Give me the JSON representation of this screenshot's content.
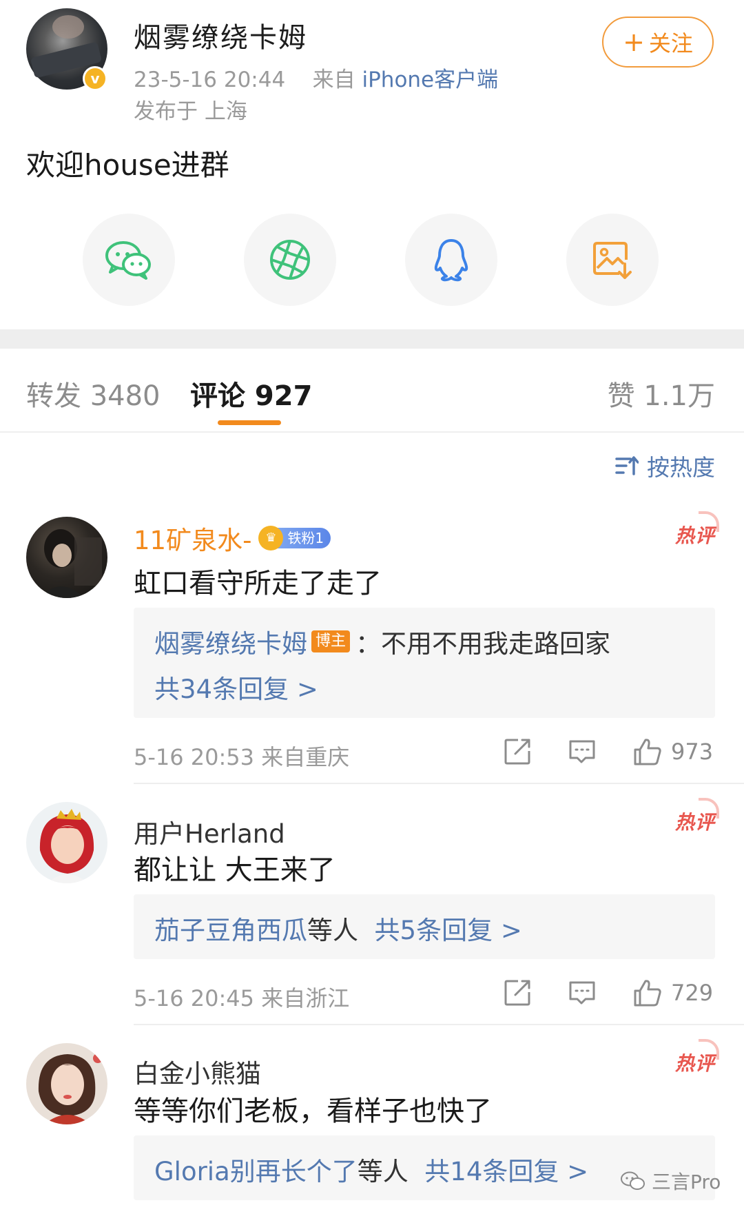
{
  "post": {
    "username": "烟雾缭绕卡姆",
    "timestamp": "23-5-16 20:44",
    "source_prefix": "来自",
    "source_device": "iPhone客户端",
    "location": "发布于 上海",
    "follow_label": "关注",
    "follow_plus": "+",
    "verified_mark": "v",
    "text": "欢迎house进群"
  },
  "share": {
    "icons": [
      "wechat-icon",
      "moments-icon",
      "qq-icon",
      "save-image-icon"
    ],
    "colors": {
      "wechat": "#3fc27a",
      "moments": "#3fc27a",
      "qq": "#3b82e8",
      "save": "#f2a03a"
    }
  },
  "tabs": {
    "repost": "转发 3480",
    "comment": "评论 927",
    "like": "赞 1.1万",
    "accent": "#f28a1d"
  },
  "sort": {
    "label": "按热度"
  },
  "comments": [
    {
      "name": "11矿泉水-",
      "fan_badge": "铁粉1",
      "hot": "热评",
      "text": "虹口看守所走了走了",
      "reply_author": "烟雾缭绕卡姆",
      "reply_author_badge": "博主",
      "reply_text": "：不用不用我走路回家",
      "reply_count": "共34条回复 >",
      "time": "5-16 20:53 来自重庆",
      "likes": "973"
    },
    {
      "name": "用户Herland",
      "hot": "热评",
      "text": "都让让 大王来了",
      "reply_users": "茄子豆角西瓜",
      "reply_users_suffix": "等人",
      "reply_count": "共5条回复 >",
      "time": "5-16 20:45 来自浙江",
      "likes": "729"
    },
    {
      "name": "白金小熊猫",
      "hot": "热评",
      "text": "等等你们老板，看样子也快了",
      "reply_users": "Gloria别再长个了",
      "reply_users_suffix": "等人",
      "reply_count": "共14条回复 >"
    }
  ],
  "watermark": {
    "text": "三言Pro"
  }
}
